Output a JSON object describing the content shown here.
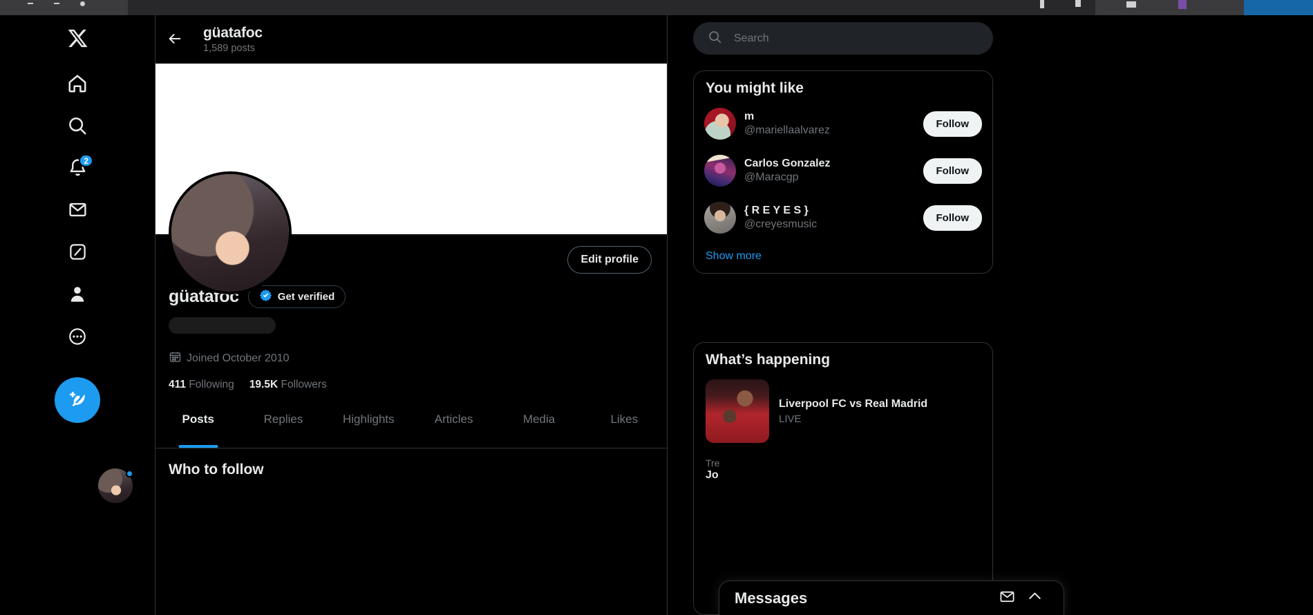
{
  "browser": {
    "chrome_visible": true
  },
  "left_nav": {
    "items": [
      {
        "name": "x-logo",
        "icon": "x-logo-icon",
        "label": ""
      },
      {
        "name": "home",
        "icon": "home-icon",
        "label": "Home"
      },
      {
        "name": "explore",
        "icon": "search-icon",
        "label": "Explore"
      },
      {
        "name": "notifications",
        "icon": "bell-icon",
        "label": "Notifications",
        "badge": "2"
      },
      {
        "name": "messages",
        "icon": "mail-icon",
        "label": "Messages"
      },
      {
        "name": "grok",
        "icon": "grok-icon",
        "label": "Grok"
      },
      {
        "name": "profile",
        "icon": "person-icon",
        "label": "Profile"
      },
      {
        "name": "more",
        "icon": "more-ellipsis-icon",
        "label": "More"
      }
    ],
    "compose": {
      "icon": "compose-post-icon",
      "label": "Post"
    },
    "account_avatar": "user-avatar"
  },
  "profile_header": {
    "back_icon": "arrow-left-icon",
    "title": "güatafoc",
    "posts_count": "1,589 posts"
  },
  "profile": {
    "banner_color": "#ffffff",
    "avatar": "profile-avatar",
    "edit_profile_label": "Edit profile",
    "display_name": "güatafoc",
    "get_verified_label": "Get verified",
    "verified_badge_color": "#1d9bf0",
    "handle_placeholder_loading": true,
    "joined_icon": "calendar-icon",
    "joined": "Joined October 2010",
    "following_count": "411",
    "following_label": "Following",
    "followers_count": "19.5K",
    "followers_label": "Followers"
  },
  "tabs": [
    {
      "label": "Posts",
      "active": true
    },
    {
      "label": "Replies",
      "active": false
    },
    {
      "label": "Highlights",
      "active": false
    },
    {
      "label": "Articles",
      "active": false
    },
    {
      "label": "Media",
      "active": false
    },
    {
      "label": "Likes",
      "active": false
    }
  ],
  "timeline": {
    "who_to_follow_title": "Who to follow"
  },
  "search": {
    "icon": "search-icon",
    "placeholder": "Search",
    "value": ""
  },
  "you_might_like": {
    "title": "You might like",
    "accounts": [
      {
        "avatar": "m-avatar",
        "name": "m",
        "handle": "@mariellaalvarez",
        "follow_label": "Follow"
      },
      {
        "avatar": "carlos-avatar",
        "name": "Carlos Gonzalez",
        "handle": "@Maracgp",
        "follow_label": "Follow"
      },
      {
        "avatar": "reyes-avatar",
        "name": "{ R E Y E S }",
        "handle": "@creyesmusic",
        "follow_label": "Follow"
      }
    ],
    "show_more_label": "Show more",
    "link_color": "#1d9bf0"
  },
  "whats_happening": {
    "title": "What’s happening",
    "items": [
      {
        "thumb": "liverpool-real-madrid-thumb",
        "title": "Liverpool FC vs Real Madrid",
        "subtitle": "LIVE"
      }
    ],
    "next_category": "Tre",
    "next_name": "Jo"
  },
  "messages_dock": {
    "title": "Messages",
    "new_message_icon": "new-message-icon",
    "expand_icon": "chevron-up-icon"
  }
}
